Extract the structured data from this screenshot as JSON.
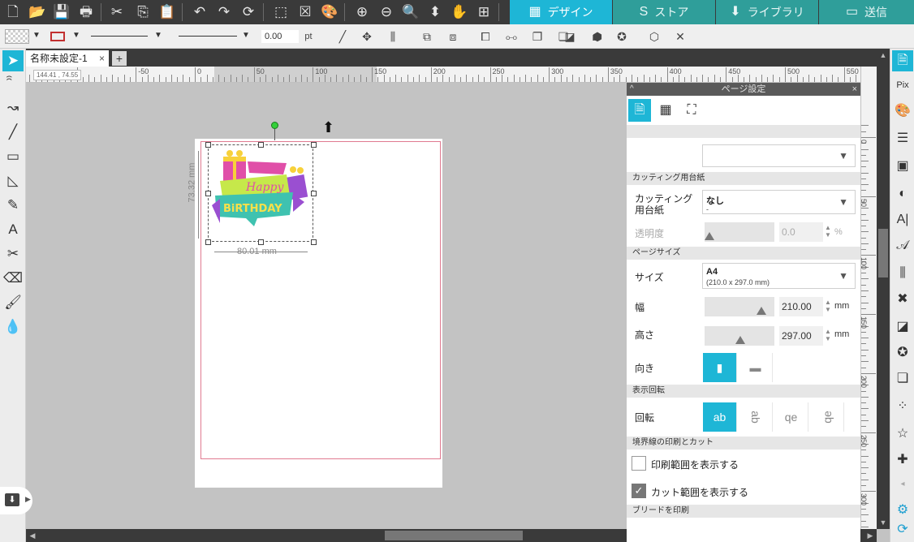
{
  "top_toolbar": {
    "buttons": [
      {
        "name": "new-file-icon",
        "glyph": "🗋"
      },
      {
        "name": "open-folder-icon",
        "glyph": "📂"
      },
      {
        "name": "save-icon",
        "glyph": "💾"
      },
      {
        "name": "print-icon",
        "glyph": "🖶"
      },
      {
        "name": "cut-icon",
        "glyph": "✂"
      },
      {
        "name": "copy-icon",
        "glyph": "⎘"
      },
      {
        "name": "paste-icon",
        "glyph": "📋"
      },
      {
        "name": "undo-icon",
        "glyph": "↶"
      },
      {
        "name": "redo-icon",
        "glyph": "↷"
      },
      {
        "name": "refresh-icon",
        "glyph": "⟳"
      },
      {
        "name": "select-all-icon",
        "glyph": "⬚"
      },
      {
        "name": "deselect-icon",
        "glyph": "☒"
      },
      {
        "name": "select-by-color-icon",
        "glyph": "🎨"
      },
      {
        "name": "zoom-in-icon",
        "glyph": "⊕"
      },
      {
        "name": "zoom-out-icon",
        "glyph": "⊖"
      },
      {
        "name": "zoom-area-icon",
        "glyph": "🔍"
      },
      {
        "name": "drag-zoom-icon",
        "glyph": "⬍"
      },
      {
        "name": "pan-hand-icon",
        "glyph": "✋"
      },
      {
        "name": "fit-page-icon",
        "glyph": "⊞"
      }
    ],
    "mode_tabs": [
      {
        "label": "デザイン",
        "icon": "▦",
        "active": true
      },
      {
        "label": "ストア",
        "icon": "S",
        "active": false
      },
      {
        "label": "ライブラリ",
        "icon": "⬇",
        "active": false
      },
      {
        "label": "送信",
        "icon": "▭",
        "active": false
      }
    ]
  },
  "sub_toolbar": {
    "line_width_value": "0.00",
    "line_width_unit": "pt",
    "icons": [
      {
        "name": "line-style-icon",
        "glyph": "╱"
      },
      {
        "name": "move-icon",
        "glyph": "✥"
      },
      {
        "name": "align-icon",
        "glyph": "⫼"
      },
      {
        "name": "group-icon",
        "glyph": "⧉"
      },
      {
        "name": "ungroup-icon",
        "glyph": "⧈"
      },
      {
        "name": "compound-path-icon",
        "glyph": "⧠"
      },
      {
        "name": "release-compound-icon",
        "glyph": "⧟"
      },
      {
        "name": "bring-front-icon",
        "glyph": "❐"
      },
      {
        "name": "send-back-icon",
        "glyph": "❏"
      },
      {
        "name": "offset-icon",
        "glyph": "◪"
      },
      {
        "name": "trace-icon",
        "glyph": "⧄"
      },
      {
        "name": "weld-icon",
        "glyph": "⬢"
      },
      {
        "name": "star-icon",
        "glyph": "✪"
      },
      {
        "name": "3d-box-icon",
        "glyph": "⬡"
      },
      {
        "name": "close-icon",
        "glyph": "✕"
      }
    ]
  },
  "document": {
    "tab_title": "名称未設定-1",
    "tab_close": "×",
    "add_tab": "+",
    "coord_readout": "144.41 , 74.55"
  },
  "canvas": {
    "dim_width": "80.01 mm",
    "dim_height": "73.32 mm",
    "artwork": {
      "line1": "Happy",
      "line2": "BiRTHDAY"
    }
  },
  "ruler_h_labels": [
    "-50",
    "0",
    "50",
    "100",
    "150",
    "200",
    "250",
    "300",
    "350",
    "400",
    "450",
    "500",
    "550"
  ],
  "ruler_v_labels": [
    "0",
    "50",
    "100",
    "150",
    "200",
    "250",
    "300"
  ],
  "panel": {
    "title": "ページ設定",
    "collapse": "^",
    "close": "×",
    "tabs": [
      {
        "name": "page-tab-icon",
        "glyph": "🗎",
        "active": true
      },
      {
        "name": "grid-tab-icon",
        "glyph": "▦",
        "active": false
      },
      {
        "name": "crop-marks-tab-icon",
        "glyph": "⛶",
        "active": false
      }
    ],
    "sections": {
      "mat": "カッティング用台紙",
      "page_size": "ページサイズ",
      "rotation_view": "表示回転",
      "print_cut_borders": "境界線の印刷とカット",
      "print_bleed": "ブリードを印刷"
    },
    "mat_label": "カッティング用台紙",
    "mat_value": "なし",
    "mat_sub": "-",
    "transparency_label": "透明度",
    "transparency_value": "0.0",
    "transparency_unit": "%",
    "size_label": "サイズ",
    "size_value": "A4",
    "size_sub": "(210.0 x 297.0 mm)",
    "width_label": "幅",
    "width_value": "210.00",
    "width_unit": "mm",
    "height_label": "高さ",
    "height_value": "297.00",
    "height_unit": "mm",
    "orientation_label": "向き",
    "rotation_label": "回転",
    "rotation_options": [
      "ab",
      "ab",
      "qe",
      "qe"
    ],
    "show_print_area": "印刷範囲を表示する",
    "show_cut_area": "カット範囲を表示する"
  },
  "right_tools": [
    {
      "name": "page-setup-icon",
      "glyph": "🗎",
      "active": true
    },
    {
      "name": "pixscan-icon",
      "glyph": "Pix"
    },
    {
      "name": "fill-color-icon",
      "glyph": "🎨"
    },
    {
      "name": "line-style-panel-icon",
      "glyph": "☰"
    },
    {
      "name": "image-effects-icon",
      "glyph": "▣"
    },
    {
      "name": "contrast-icon",
      "glyph": "◐"
    },
    {
      "name": "text-style-icon",
      "glyph": "A|"
    },
    {
      "name": "sketch-font-icon",
      "glyph": "𝒜"
    },
    {
      "name": "align-panel-icon",
      "glyph": "⫼"
    },
    {
      "name": "transform-icon",
      "glyph": "✖"
    },
    {
      "name": "offset-panel-icon",
      "glyph": "◪"
    },
    {
      "name": "replicate-icon",
      "glyph": "✪"
    },
    {
      "name": "layers-icon",
      "glyph": "❏"
    },
    {
      "name": "dots-icon",
      "glyph": "⁘"
    },
    {
      "name": "star-outline-icon",
      "glyph": "☆"
    },
    {
      "name": "puzzle-icon",
      "glyph": "✚"
    },
    {
      "name": "expand-left-icon",
      "glyph": "◂"
    },
    {
      "name": "settings-icon",
      "glyph": "⚙"
    },
    {
      "name": "sync-icon",
      "glyph": "⟳"
    }
  ],
  "left_tools": [
    {
      "name": "select-arrow-icon",
      "glyph": "➤",
      "active": true
    },
    {
      "name": "lasso-icon",
      "glyph": "ꩰ"
    },
    {
      "name": "edit-points-icon",
      "glyph": "↝"
    },
    {
      "name": "line-tool-icon",
      "glyph": "╱"
    },
    {
      "name": "rectangle-tool-icon",
      "glyph": "▭"
    },
    {
      "name": "shape-tool-icon",
      "glyph": "◺"
    },
    {
      "name": "pencil-tool-icon",
      "glyph": "✎"
    },
    {
      "name": "text-tool-icon",
      "glyph": "A"
    },
    {
      "name": "knife-tool-icon",
      "glyph": "✂"
    },
    {
      "name": "eraser-tool-icon",
      "glyph": "⌫"
    },
    {
      "name": "brush-tool-icon",
      "glyph": "🖌"
    },
    {
      "name": "eyedropper-tool-icon",
      "glyph": "💧"
    }
  ],
  "colors": {
    "accent": "#1eb6d6",
    "mode_tab": "#2f9e9a",
    "toolbar_dark": "#3a3a3a",
    "cut_line": "#e07a90"
  }
}
